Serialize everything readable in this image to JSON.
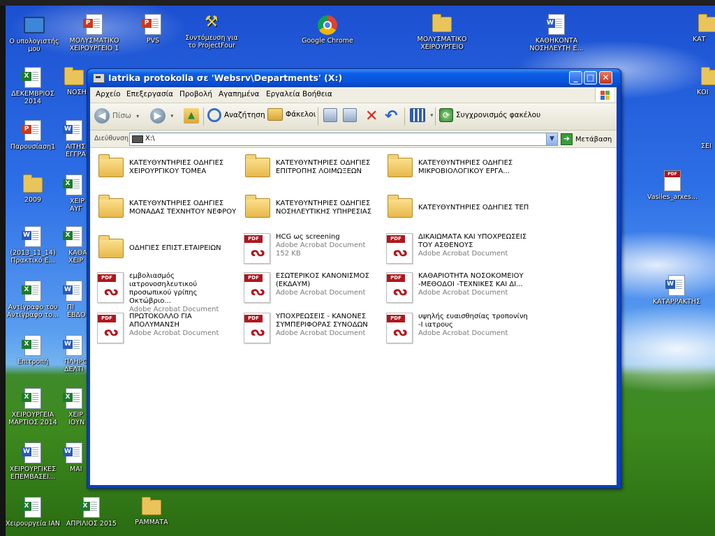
{
  "window": {
    "title": "Iatrika protokolla σε 'Websrv\\Departments' (X:)",
    "min_label": "_",
    "max_label": "□",
    "close_label": "✕"
  },
  "menu": [
    "Αρχείο",
    "Επεξεργασία",
    "Προβολή",
    "Αγαπημένα",
    "Εργαλεία",
    "Βοήθεια"
  ],
  "toolbar": {
    "back": "Πίσω",
    "search": "Αναζήτηση",
    "folders": "Φάκελοι",
    "sync": "Συγχρονισμός φακέλου"
  },
  "address": {
    "label": "Διεύθυνση",
    "value": "X:\\",
    "go": "Μετάβαση"
  },
  "items": [
    {
      "kind": "folder",
      "name": "ΚΑΤΕΥΘΥΝΤΗΡΙΕΣ ΟΔΗΓΙΕΣ ΧΕΙΡΟΥΡΓΙΚΟΥ ΤΟΜΕΑ"
    },
    {
      "kind": "folder",
      "name": "ΚΑΤΕΥΘΥΝΤΗΡΙΕΣ ΟΔΗΓΙΕΣ ΕΠΙΤΡΟΠΗΣ ΛΟΙΜΩΞΕΩΝ"
    },
    {
      "kind": "folder",
      "name": "ΚΑΤΕΥΘΥΝΤΗΡΙΕΣ ΟΔΗΓΙΕΣ ΜΙΚΡΟΒΙΟΛΟΓΙΚΟΥ ΕΡΓΑ..."
    },
    {
      "kind": "folder",
      "name": "ΚΑΤΕΥΘΥΝΤΗΡΙΕΣ ΟΔΗΓΙΕΣ ΜΟΝΑΔΑΣ ΤΕΧΝΗΤΟΥ ΝΕΦΡΟΥ"
    },
    {
      "kind": "folder",
      "name": "ΚΑΤΕΥΘΥΝΤΗΡΙΕΣ ΟΔΗΓΙΕΣ ΝΟΣΗΛΕΥΤΙΚΗΣ ΥΠΗΡΕΣΙΑΣ"
    },
    {
      "kind": "folder",
      "name": "ΚΑΤΕΥΘΥΝΤΗΡΙΕΣ ΟΔΗΓΙΕΣ ΤΕΠ"
    },
    {
      "kind": "folder",
      "name": "ΟΔΗΓΙΕΣ ΕΠΙΣΤ.ΕΤΑΙΡΕΙΩΝ"
    },
    {
      "kind": "pdf",
      "name": "HCG ως screening",
      "type": "Adobe Acrobat Document",
      "size": "152 KB"
    },
    {
      "kind": "pdf",
      "name": "ΔΙΚΑΙΩΜΑΤΑ ΚΑΙ ΥΠΟΧΡΕΩΣΕΙΣ ΤΟΥ ΑΣΘΕΝΟΥΣ",
      "type": "Adobe Acrobat Document"
    },
    {
      "kind": "pdf",
      "name": "εμβολιασμός ιατρονοσηλευτικού προσωπικού γρίπης Οκτώβριο...",
      "type": "Adobe Acrobat Document"
    },
    {
      "kind": "pdf",
      "name": "ΕΣΩΤΕΡΙΚΟΣ ΚΑΝΟΝΙΣΜΟΣ (ΕΚΔΑΥΜ)",
      "type": "Adobe Acrobat Document"
    },
    {
      "kind": "pdf",
      "name": "ΚΑΘΑΡΙΟΤΗΤΑ ΝΟΣΟΚΟΜΕΙΟΥ -ΜΕΘΟΔΟΙ -ΤΕΧΝΙΚΕΣ ΚΑΙ ΔΙ...",
      "type": "Adobe Acrobat Document"
    },
    {
      "kind": "pdf",
      "name": "ΠΡΩΤΟΚΟΛΛΟ ΓΙΑ ΑΠΟΛΥΜΑΝΣΗ",
      "type": "Adobe Acrobat Document"
    },
    {
      "kind": "pdf",
      "name": "ΥΠΟΧΡΕΩΣΕΙΣ - ΚΑΝΟΝΕΣ ΣΥΜΠΕΡΙΦΟΡΑΣ ΣΥΝΟΔΩΝ",
      "type": "Adobe Acrobat Document"
    },
    {
      "kind": "pdf",
      "name": "υψηλής ευαισθησίας τροπονίνη -Ι ιατρους",
      "type": "Adobe Acrobat Document"
    }
  ],
  "desktop": {
    "icons": [
      {
        "label": "Ο υπολογιστής μου",
        "icon": "monitor-icon"
      },
      {
        "label": "ΜΟΛΥΣΜΑΤΙΚΟ ΧΕΙΡΟΥΡΓΕΙΟ 1",
        "icon": "ppt-icon"
      },
      {
        "label": "PVS",
        "icon": "ppt-icon"
      },
      {
        "label": "Συντόμευση για το ProjectFour",
        "icon": "wrench-icon"
      },
      {
        "label": "Google Chrome",
        "icon": "chrome-icon"
      },
      {
        "label": "ΜΟΛΥΣΜΑΤΙΚΟ ΧΕΙΡΟΥΡΓΕΙΟ",
        "icon": "folder-icon"
      },
      {
        "label": "ΚΑΘΗΚΟΝΤΑ ΝΟΣΗΛΕΥΤΗ Ε...",
        "icon": "word-icon"
      },
      {
        "label": "ΚΑΤ",
        "icon": "folder-icon"
      },
      {
        "label": "ΔΕΚΕΜΒΡΙΟΣ 2014",
        "icon": "excel-icon"
      },
      {
        "label": "ΝΟΣΗ",
        "icon": "folder-icon"
      },
      {
        "label": "ΚΟΙ",
        "icon": "folder-icon"
      },
      {
        "label": "Παρουσίαση1",
        "icon": "ppt-icon"
      },
      {
        "label": "ΑΙΤΗΣ ΕΓΓΡΑ",
        "icon": "word-icon"
      },
      {
        "label": "ΣΕΙ",
        "icon": "folder-icon"
      },
      {
        "label": "2009",
        "icon": "folder-icon"
      },
      {
        "label": "ΧΕΙΡ ΑΥΓ",
        "icon": "excel-icon"
      },
      {
        "label": "Vasiles_arxes...",
        "icon": "pdf-icon"
      },
      {
        "label": "(2013_11_14) Πρακτικό Ε...",
        "icon": "word-icon"
      },
      {
        "label": "ΚΑΘΑ ΧΕΙΡ",
        "icon": "excel-icon"
      },
      {
        "label": "Αντίγραφο του Αντίγραφο το...",
        "icon": "excel-icon"
      },
      {
        "label": "ΠΙ ΕΒΔΟ",
        "icon": "word-icon"
      },
      {
        "label": "ΚΑΤΑΡΡΑΚΤΗΣ",
        "icon": "word-icon"
      },
      {
        "label": "Επιτροπή",
        "icon": "excel-icon"
      },
      {
        "label": "ΠΛΗΡΟ ΔΕΛΤΙ",
        "icon": "word-icon"
      },
      {
        "label": "ΧΕΙΡΟΥΡΓΕΙΑ ΜΑΡΤΙΟΣ 2014",
        "icon": "excel-icon"
      },
      {
        "label": "ΧΕΙΡ ΙΟΥΝ",
        "icon": "excel-icon"
      },
      {
        "label": "ΧΕΙΡΟΥΡΓΙΚΕΣ ΕΠΕΜΒΑΣΕΙ...",
        "icon": "word-icon"
      },
      {
        "label": "ΜΑΙ",
        "icon": "word-icon"
      },
      {
        "label": "Χειρουργεία ΙΑΝ",
        "icon": "excel-icon"
      },
      {
        "label": "ΑΠΡΙΛΙΟΣ 2015",
        "icon": "excel-icon"
      },
      {
        "label": "ΡΑΜΜΑΤΑ",
        "icon": "folder-icon"
      }
    ]
  }
}
